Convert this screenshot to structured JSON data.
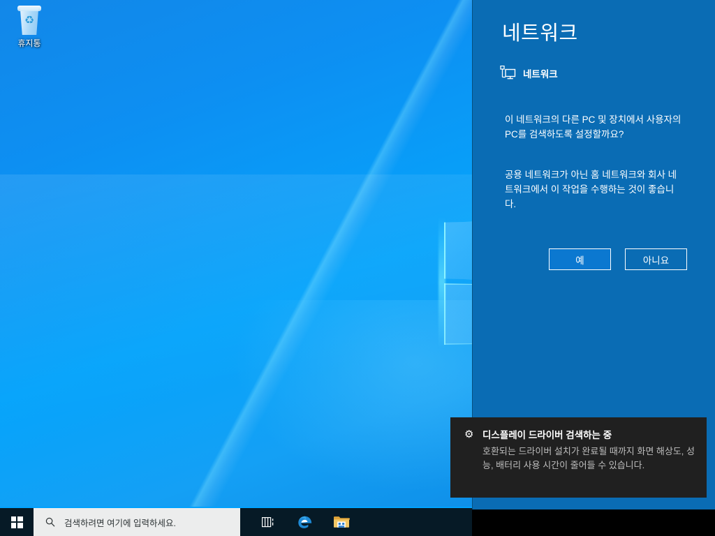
{
  "desktop": {
    "recycle_bin": {
      "label": "휴지통",
      "icon": "recycle-bin-icon"
    },
    "wallpaper_name": "windows-10-hero-wallpaper"
  },
  "flyout": {
    "title": "네트워크",
    "subhead": {
      "icon": "network-icon",
      "label": "네트워크"
    },
    "question": "이 네트워크의 다른 PC 및 장치에서 사용자의 PC를 검색하도록 설정할까요?",
    "advice": "공용 네트워크가 아닌 홈 네트워크와 회사 네트워크에서 이 작업을 수행하는 것이 좋습니다.",
    "buttons": {
      "yes": "예",
      "no": "아니요"
    },
    "colors": {
      "panel_background": "#0a6cb4",
      "primary_button": "#0b78d0",
      "text": "#ffffff"
    }
  },
  "toast": {
    "icon": "gear-icon",
    "title": "디스플레이 드라이버 검색하는 중",
    "body": "호환되는 드라이버 설치가 완료될 때까지 화면 해상도, 성능, 배터리 사용 시간이 줄어들 수 있습니다.",
    "colors": {
      "background": "#202020",
      "title_text": "#ffffff",
      "body_text": "#bdbdbd"
    }
  },
  "taskbar": {
    "start_button": "start-button",
    "search": {
      "icon": "search-icon",
      "placeholder": "검색하려면 여기에 입력하세요."
    },
    "items": [
      {
        "name": "task-view-button",
        "icon": "task-view-icon"
      },
      {
        "name": "edge-button",
        "icon": "edge-icon"
      },
      {
        "name": "explorer-button",
        "icon": "file-explorer-icon"
      }
    ],
    "colors": {
      "background": "#061a26",
      "search_background": "#eceded",
      "accent_line": "#00a2ff"
    }
  }
}
